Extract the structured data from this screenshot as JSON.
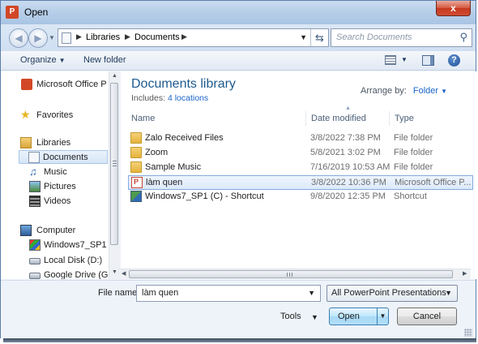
{
  "window": {
    "title": "Open",
    "close_glyph": "x"
  },
  "address": {
    "crumbs": [
      "Libraries",
      "Documents"
    ],
    "search_placeholder": "Search Documents"
  },
  "toolbar": {
    "organize": "Organize",
    "new_folder": "New folder"
  },
  "nav": {
    "office": "Microsoft Office P",
    "favorites": "Favorites",
    "libraries": "Libraries",
    "documents": "Documents",
    "music": "Music",
    "pictures": "Pictures",
    "videos": "Videos",
    "computer": "Computer",
    "win7": "Windows7_SP1 (",
    "local_d": "Local Disk (D:)",
    "gdrive": "Google Drive (G:)"
  },
  "library": {
    "title": "Documents library",
    "includes_label": "Includes:",
    "includes_link": "4 locations",
    "arrange_label": "Arrange by:",
    "arrange_value": "Folder"
  },
  "columns": {
    "name": "Name",
    "date": "Date modified",
    "type": "Type"
  },
  "files": [
    {
      "name": "Zalo Received Files",
      "date": "3/8/2022 7:38 PM",
      "type": "File folder",
      "icon": "folder-icon"
    },
    {
      "name": "Zoom",
      "date": "5/8/2021 3:02 PM",
      "type": "File folder",
      "icon": "folder-icon"
    },
    {
      "name": "Sample Music",
      "date": "7/16/2019 10:53 AM",
      "type": "File folder",
      "icon": "folder-icon"
    },
    {
      "name": "làm quen",
      "date": "3/8/2022 10:36 PM",
      "type": "Microsoft Office P...",
      "icon": "powerpoint-file-icon",
      "selected": true
    },
    {
      "name": "Windows7_SP1 (C) - Shortcut",
      "date": "9/8/2020 12:35 PM",
      "type": "Shortcut",
      "icon": "shortcut-icon"
    }
  ],
  "footer": {
    "file_name_label": "File name:",
    "file_name_value": "làm quen",
    "filter": "All PowerPoint Presentations",
    "tools": "Tools",
    "open": "Open",
    "cancel": "Cancel"
  },
  "colors": {
    "accent": "#1a64c8",
    "title_blue": "#1e5a8e",
    "selection": "#dceafb"
  }
}
